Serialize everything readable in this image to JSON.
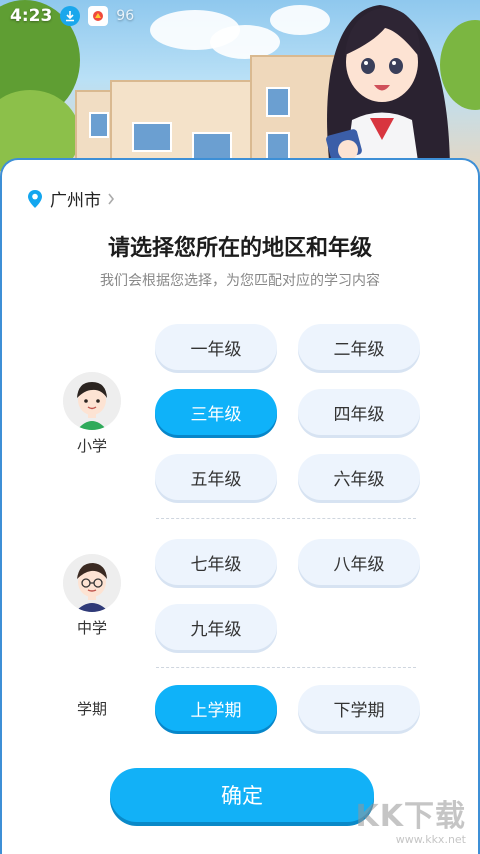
{
  "status_bar": {
    "time": "4:23",
    "battery": "96"
  },
  "location": {
    "city": "广州市"
  },
  "header": {
    "title": "请选择您所在的地区和年级",
    "subtitle": "我们会根据您选择，为您匹配对应的学习内容"
  },
  "primary": {
    "label": "小学",
    "grades": [
      "一年级",
      "二年级",
      "三年级",
      "四年级",
      "五年级",
      "六年级"
    ],
    "selected": "三年级"
  },
  "middle": {
    "label": "中学",
    "grades": [
      "七年级",
      "八年级",
      "九年级"
    ]
  },
  "semester": {
    "label": "学期",
    "options": [
      "上学期",
      "下学期"
    ],
    "selected": "上学期"
  },
  "confirm_label": "确定",
  "watermark": {
    "brand": "KK下载",
    "url": "www.kkx.net"
  },
  "colors": {
    "accent": "#0fb2f9",
    "button_bg": "#edf4fd",
    "card_border": "#3d8fd6"
  }
}
